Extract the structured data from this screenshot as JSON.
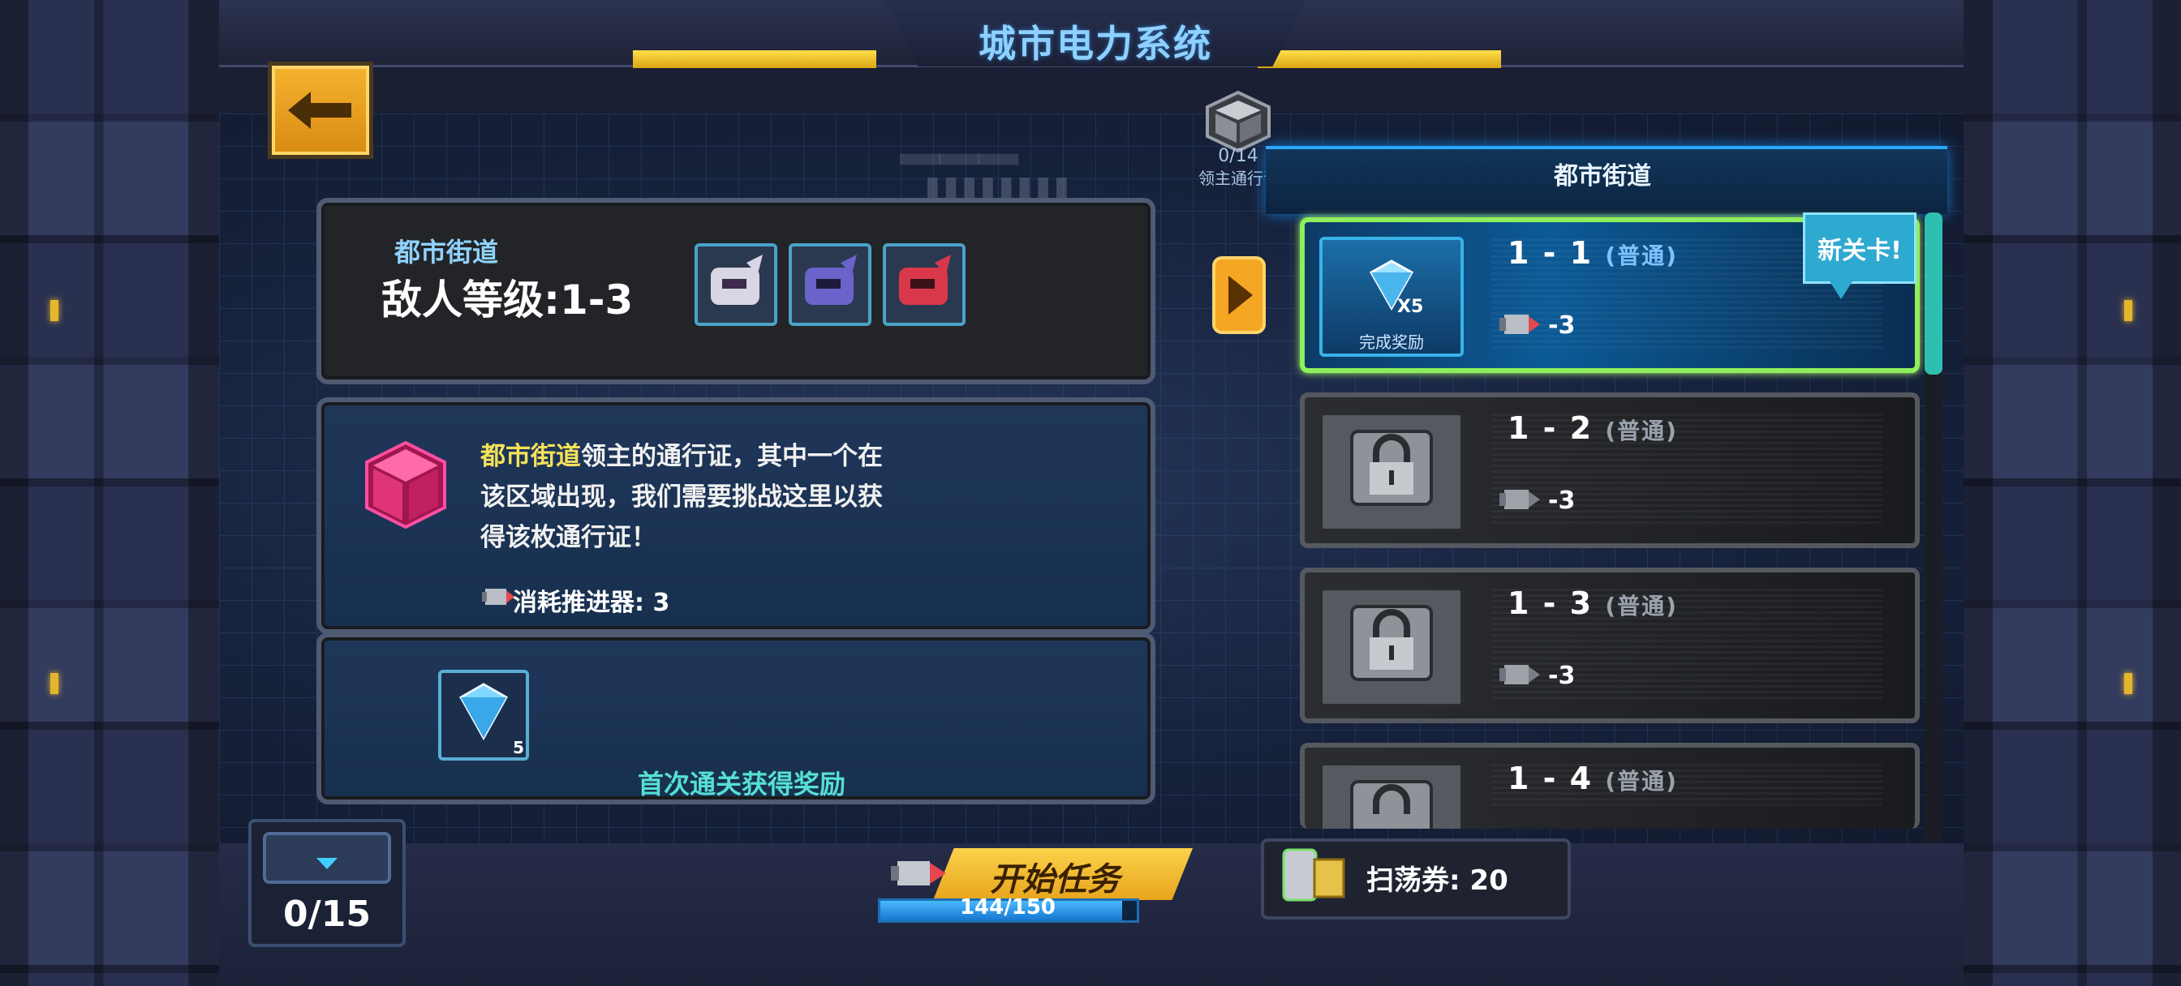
{
  "header": {
    "title": "城市电力系统"
  },
  "pass": {
    "count": "0/14",
    "label": "领主通行证"
  },
  "area_header": {
    "label": "都市街道"
  },
  "info_panel": {
    "area_name": "都市街道",
    "enemy_level": "敌人等级:1-3"
  },
  "description": {
    "highlight": "都市街道",
    "line1_rest": "领主的通行证，其中一个在",
    "line2": "该区域出现，我们需要挑战这里以获",
    "line3": "得该枚通行证！",
    "cost_label": "消耗推进器: 3"
  },
  "rewards_panel": {
    "item_count": "5",
    "caption": "首次通关获得奖励"
  },
  "levels": [
    {
      "name": "1 - 1",
      "difficulty": "(普通)",
      "cost": "-3",
      "reward_count": "X5",
      "reward_label": "完成奖励",
      "state": "unlocked"
    },
    {
      "name": "1 - 2",
      "difficulty": "(普通)",
      "cost": "-3",
      "state": "locked"
    },
    {
      "name": "1 - 3",
      "difficulty": "(普通)",
      "cost": "-3",
      "state": "locked"
    },
    {
      "name": "1 - 4",
      "difficulty": "(普通)",
      "state": "locked"
    }
  ],
  "new_tag": "新关卡!",
  "chest_counter": "0/15",
  "start_button": {
    "label": "开始任务",
    "energy_text": "144/150",
    "energy_fraction": 0.96
  },
  "sweep": {
    "label": "扫荡券: 20"
  },
  "colors": {
    "accent_cyan": "#55e0d2",
    "highlight_yellow": "#f3e25a",
    "active_border": "#8fee5c",
    "title_blue": "#8ed0ff",
    "button_orange": "#f5b330"
  },
  "icons": [
    "back-arrow-icon",
    "pass-cube-icon",
    "play-arrow-icon",
    "diamond-icon",
    "lock-icon",
    "booster-icon",
    "pink-cube-icon",
    "chest-icon",
    "sweep-ticket-icon"
  ]
}
